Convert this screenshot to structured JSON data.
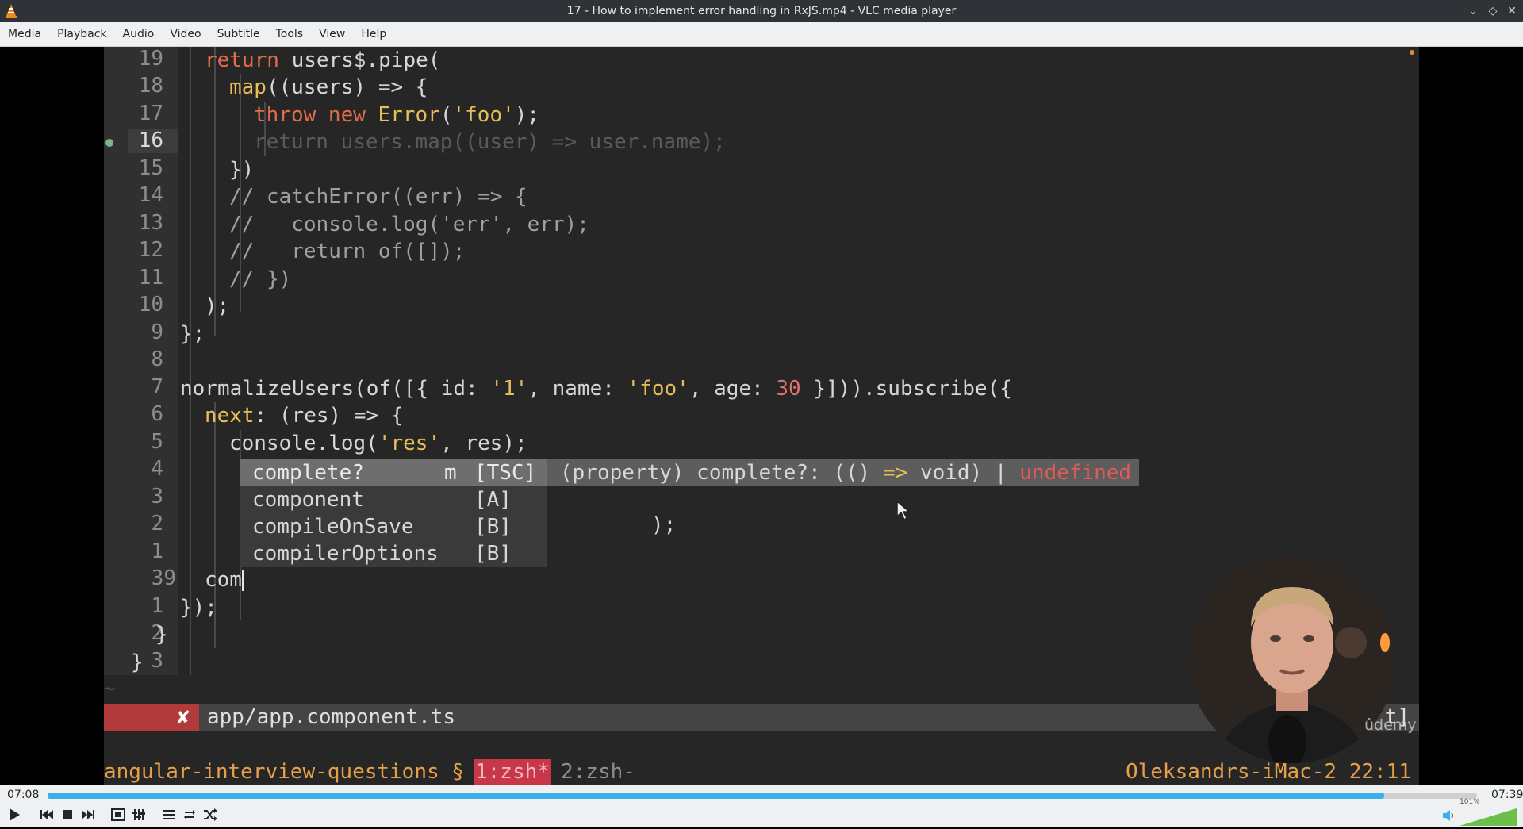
{
  "window": {
    "title": "17 - How to implement error handling in RxJS.mp4 - VLC media player"
  },
  "menu": [
    "Media",
    "Playback",
    "Audio",
    "Video",
    "Subtitle",
    "Tools",
    "View",
    "Help"
  ],
  "editor": {
    "line_numbers": [
      "19",
      "18",
      "17",
      "16",
      "15",
      "14",
      "13",
      "12",
      "11",
      "10",
      "9",
      "8",
      "7",
      "6",
      "5",
      "4",
      "3",
      "2",
      "1",
      "39",
      "1",
      "2",
      "3"
    ],
    "autocomplete": [
      {
        "name": "complete?",
        "kind": "m",
        "source": "[TSC]"
      },
      {
        "name": "component",
        "kind": "",
        "source": "[A]"
      },
      {
        "name": "compileOnSave",
        "kind": "",
        "source": "[B]"
      },
      {
        "name": "compilerOptions",
        "kind": "",
        "source": "[B]"
      }
    ],
    "doc_prefix": "(property) complete?: (() ",
    "doc_arrow": "=>",
    "doc_mid": " void) | ",
    "doc_undefined": "undefined",
    "tilde": "~",
    "status_error": "✘",
    "status_file": "app/app.component.ts",
    "status_right": "t]",
    "tmux_session": "angular-interview-questions §",
    "tmux_active": "1:zsh*",
    "tmux_other": "2:zsh-",
    "tmux_host": "Oleksandrs-iMac-2 22:11"
  },
  "watermark": "ûdemy",
  "player": {
    "elapsed": "07:08",
    "total": "07:39",
    "progress": 0.935,
    "volume_label": "101%",
    "volume": 1.01
  },
  "colors": {
    "accent": "#3daee9",
    "keyword": "#e06c4a",
    "string": "#e7bd58",
    "error": "#b33a3a"
  }
}
